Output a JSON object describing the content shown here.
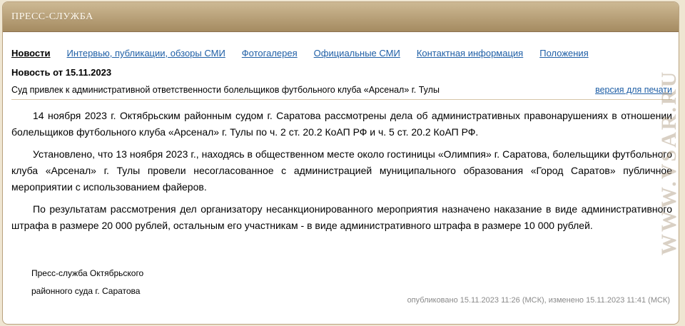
{
  "header": {
    "title": "ПРЕСС-СЛУЖБА"
  },
  "nav": {
    "items": [
      {
        "label": "Новости"
      },
      {
        "label": "Интервью, публикации, обзоры СМИ"
      },
      {
        "label": "Фотогалерея"
      },
      {
        "label": "Официальные СМИ"
      },
      {
        "label": "Контактная информация"
      },
      {
        "label": "Положения"
      }
    ]
  },
  "news": {
    "date_label": "Новость от 15.11.2023",
    "headline": "Суд привлек к административной ответственности болельщиков футбольного клуба «Арсенал» г. Тулы",
    "print_label": "версия для печати",
    "paragraphs": [
      "14 ноября 2023 г. Октябрьским районным судом г. Саратова рассмотрены дела об административных правонарушениях в отношении болельщиков футбольного клуба «Арсенал» г. Тулы по ч. 2 ст. 20.2 КоАП РФ и ч. 5 ст. 20.2 КоАП РФ.",
      "Установлено, что 13 ноября 2023 г., находясь в общественном месте около гостиницы «Олимпия» г. Саратова, болельщики футбольного клуба «Арсенал» г. Тулы провели несогласованное с администрацией муниципального образования «Город Саратов» публичное мероприятии с использованием файеров.",
      "По результатам рассмотрения дел организатору несанкционированного мероприятия назначено наказание в виде административного штрафа в размере 20 000 рублей, остальным его участникам - в виде административного штрафа в размере 10 000 рублей."
    ],
    "signature_line1": "Пресс-служба Октябрьского",
    "signature_line2": "районного суда г. Саратова",
    "published": "опубликовано 15.11.2023 11:26 (МСК), изменено 15.11.2023 11:41 (МСК)"
  },
  "watermark": {
    "text": "WWW.VSAR.RU"
  },
  "colors": {
    "header": "#b9a27e",
    "link": "#1f5fa6",
    "page_bg": "#efe6d2"
  }
}
